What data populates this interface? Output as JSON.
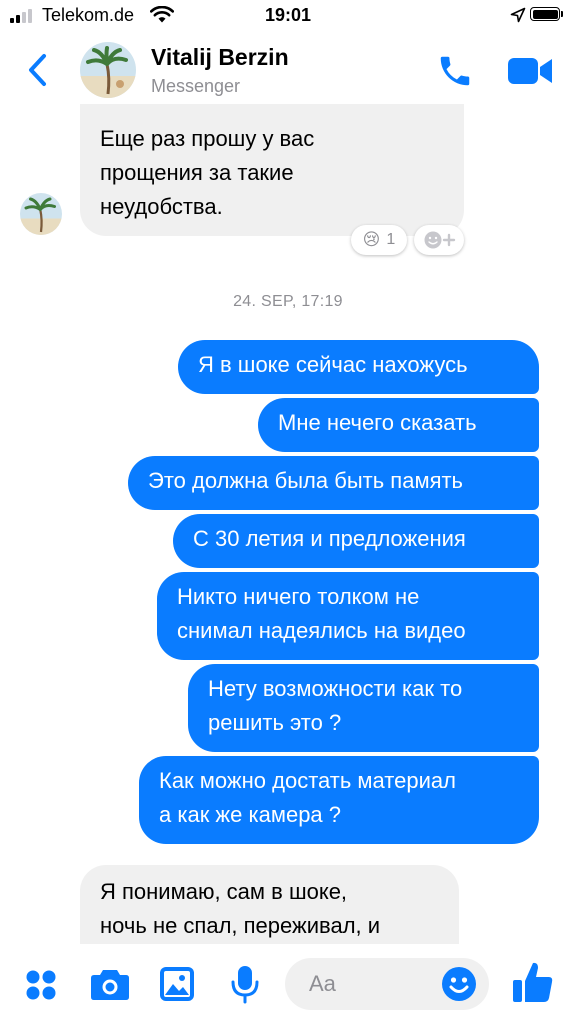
{
  "status_bar": {
    "carrier": "Telekom.de",
    "time": "19:01"
  },
  "header": {
    "name": "Vitalij Berzin",
    "subtitle": "Messenger"
  },
  "messages_before": [
    {
      "from": "contact",
      "text": "Еще раз прошу у вас\nпрощения за такие\nнеудобства."
    }
  ],
  "reaction": {
    "emoji": "😢",
    "count": "1"
  },
  "date_separator": "24. SEP, 17:19",
  "outgoing": [
    {
      "text": "Я в шоке сейчас нахожусь"
    },
    {
      "text": "Мне нечего сказать"
    },
    {
      "text": "Это должна была быть память"
    },
    {
      "text": "С 30 летия и предложения"
    },
    {
      "text": "Никто ничего толком не\nснимал надеялись на видео"
    },
    {
      "text": "Нету возможности как то\nрешить это ?"
    },
    {
      "text": "Как можно достать материал\nа как же камера ?"
    }
  ],
  "incoming_last": {
    "text": "Я понимаю, сам в шоке,\nночь не спал, переживал, и"
  },
  "composer": {
    "placeholder": "Aa"
  },
  "colors": {
    "accent": "#0a7cff",
    "incoming_bubble": "#f0f0f0",
    "secondary_text": "#8e8e93"
  },
  "icons": [
    "back-icon",
    "phone-icon",
    "video-camera-icon",
    "apps-grid-icon",
    "camera-icon",
    "gallery-icon",
    "microphone-icon",
    "emoji-icon",
    "like-thumbs-up-icon"
  ]
}
